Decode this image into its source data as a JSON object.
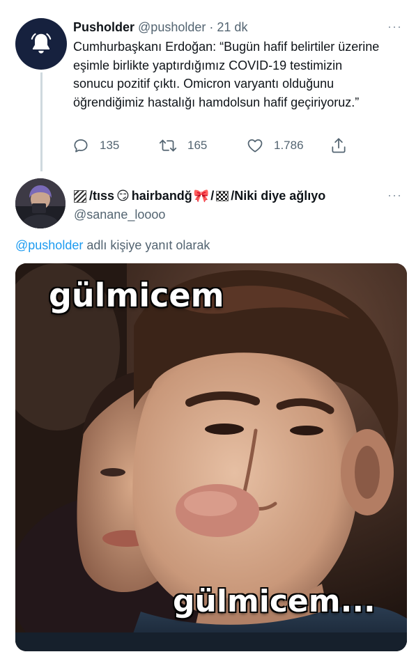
{
  "tweet": {
    "author_name": "Pusholder",
    "author_handle": "@pusholder",
    "separator": "·",
    "time": "21 dk",
    "text": "Cumhurbaşkanı Erdoğan: “Bugün hafif belirtiler üzerine eşimle birlikte yaptırdığımız COVID-19 testimizin sonucu pozitif çıktı. Omicron varyantı olduğunu öğrendiğimiz hastalığı hamdolsun hafif geçiriyoruz.”",
    "more": "···",
    "replies": "135",
    "retweets": "165",
    "likes": "1.786",
    "avatar_icon": "bell-icon"
  },
  "reply": {
    "name_part1": "/tıss",
    "name_part2": " hairbandğ",
    "name_part3": "/",
    "name_part4": "/Niki diye ağlıyo",
    "handle": "@sanane_loooo",
    "more": "···",
    "reply_to_mention": "@pusholder",
    "reply_to_text": " adlı kişiye yanıt olarak",
    "smirk_emoji": "😏",
    "bow_emoji": "🎀"
  },
  "media": {
    "caption_top": "gülmicem",
    "caption_bottom": "gülmicem..."
  },
  "colors": {
    "accent": "#1d9bf0",
    "secondary_text": "#536471",
    "avatar_bg": "#16213e"
  }
}
